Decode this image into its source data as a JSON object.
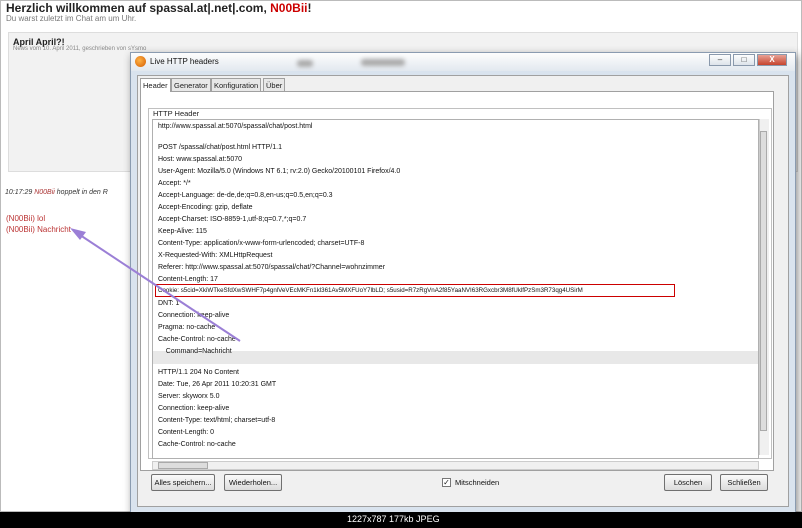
{
  "background": {
    "title": "Herzlich willkommen auf spassal.at|.net|.com,",
    "title_user": "N00Bii",
    "title_end": "!",
    "subtitle": "Du warst zuletzt im Chat am um Uhr.",
    "news_title": "April April?!",
    "news_meta": "News vom 10. April 2011, geschrieben von sYsmo",
    "chat_time": "10:17:29",
    "chat_user": "N00Bii",
    "chat_text": "hoppelt in den R",
    "chat_msg1": "(N00Bii) lol",
    "chat_msg2": "(N00Bii) Nachricht"
  },
  "window": {
    "title": "Live HTTP headers",
    "controls": {
      "minimize": "–",
      "maximize": "□",
      "close": "X"
    },
    "tabs": [
      {
        "label": "Header",
        "active": true
      },
      {
        "label": "Generator",
        "active": false
      },
      {
        "label": "Konfiguration",
        "active": false
      },
      {
        "label": "Über",
        "active": false
      }
    ],
    "group_label": "HTTP Header",
    "lines": [
      "http://www.spassal.at:5070/spassal/chat/post.html",
      "",
      "POST /spassal/chat/post.html HTTP/1.1",
      "Host: www.spassal.at:5070",
      "User-Agent: Mozilla/5.0 (Windows NT 6.1; rv:2.0) Gecko/20100101 Firefox/4.0",
      "Accept: */*",
      "Accept-Language: de-de,de;q=0.8,en-us;q=0.5,en;q=0.3",
      "Accept-Encoding: gzip, deflate",
      "Accept-Charset: ISO-8859-1,utf-8;q=0.7,*;q=0.7",
      "Keep-Alive: 115",
      "Content-Type: application/x-www-form-urlencoded; charset=UTF-8",
      "X-Requested-With: XMLHttpRequest",
      "Referer: http://www.spassal.at:5070/spassal/chat/?Channel=wohnzimmer",
      "Content-Length: 17",
      "Cookie: s5cid=XkiWTkeSfdXwSWHF7p4gnlVeVEcMKFn1kl361Av5MXFUoY7lbLD; s5usid=R7zRgVnA2f85YaaNVI63RGxcbr3M8fUklfPzSm3R73qg4USirM",
      "DNT: 1",
      "Connection: keep-alive",
      "Pragma: no-cache",
      "Cache-Control: no-cache",
      "    Command=Nachricht",
      "",
      "HTTP/1.1 204 No Content",
      "Date: Tue, 26 Apr 2011 10:20:31 GMT",
      "Server: skyworx 5.0",
      "Connection: keep-alive",
      "Content-Type: text/html; charset=utf-8",
      "Content-Length: 0",
      "Cache-Control: no-cache"
    ],
    "buttons": {
      "save_all": "Alles speichern...",
      "repeat": "Wiederholen...",
      "clear": "Löschen",
      "close": "Schließen"
    },
    "capture_label": "Mitschneiden",
    "capture_checked": true,
    "capture_mark": "✓"
  },
  "status": "1227x787  177kb  JPEG",
  "colors": {
    "highlight": "#cc0000",
    "arrow": "#9b7fd6",
    "chat_name": "#b33333"
  }
}
